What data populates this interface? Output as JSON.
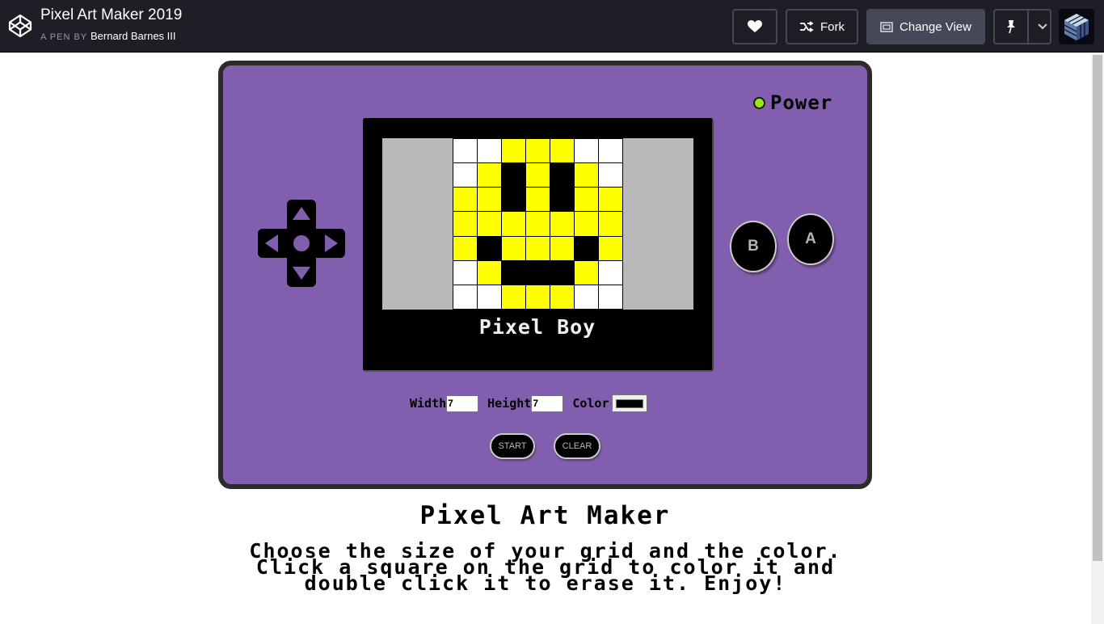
{
  "header": {
    "pen_title": "Pixel Art Maker 2019",
    "pen_by_label": "A PEN BY",
    "author": "Bernard Barnes III",
    "fork_label": "Fork",
    "change_view_label": "Change View"
  },
  "console": {
    "power_label": "Power",
    "power_led_color": "#9be31b",
    "screen_title": "Pixel Boy",
    "button_b": "B",
    "button_a": "A",
    "grid_rows": [
      [
        "W",
        "W",
        "Y",
        "Y",
        "Y",
        "W",
        "W"
      ],
      [
        "W",
        "Y",
        "K",
        "Y",
        "K",
        "Y",
        "W"
      ],
      [
        "Y",
        "Y",
        "K",
        "Y",
        "K",
        "Y",
        "Y"
      ],
      [
        "Y",
        "Y",
        "Y",
        "Y",
        "Y",
        "Y",
        "Y"
      ],
      [
        "Y",
        "K",
        "Y",
        "Y",
        "Y",
        "K",
        "Y"
      ],
      [
        "W",
        "Y",
        "K",
        "K",
        "K",
        "Y",
        "W"
      ],
      [
        "W",
        "W",
        "Y",
        "Y",
        "Y",
        "W",
        "W"
      ]
    ],
    "palette": {
      "W": "#ffffff",
      "Y": "#ffff00",
      "K": "#000000"
    }
  },
  "form": {
    "width_label": "Width",
    "width_value": "7",
    "height_label": "Height",
    "height_value": "7",
    "color_label": "Color",
    "color_value": "#000000",
    "start_label": "START",
    "clear_label": "CLEAR"
  },
  "page": {
    "title": "Pixel Art Maker",
    "description": "Choose the size of your grid and the color. Click a square on the grid to color it and double click it to erase it. Enjoy!"
  },
  "colors": {
    "console_body": "#825fae",
    "header_bg": "#1e1f26"
  }
}
